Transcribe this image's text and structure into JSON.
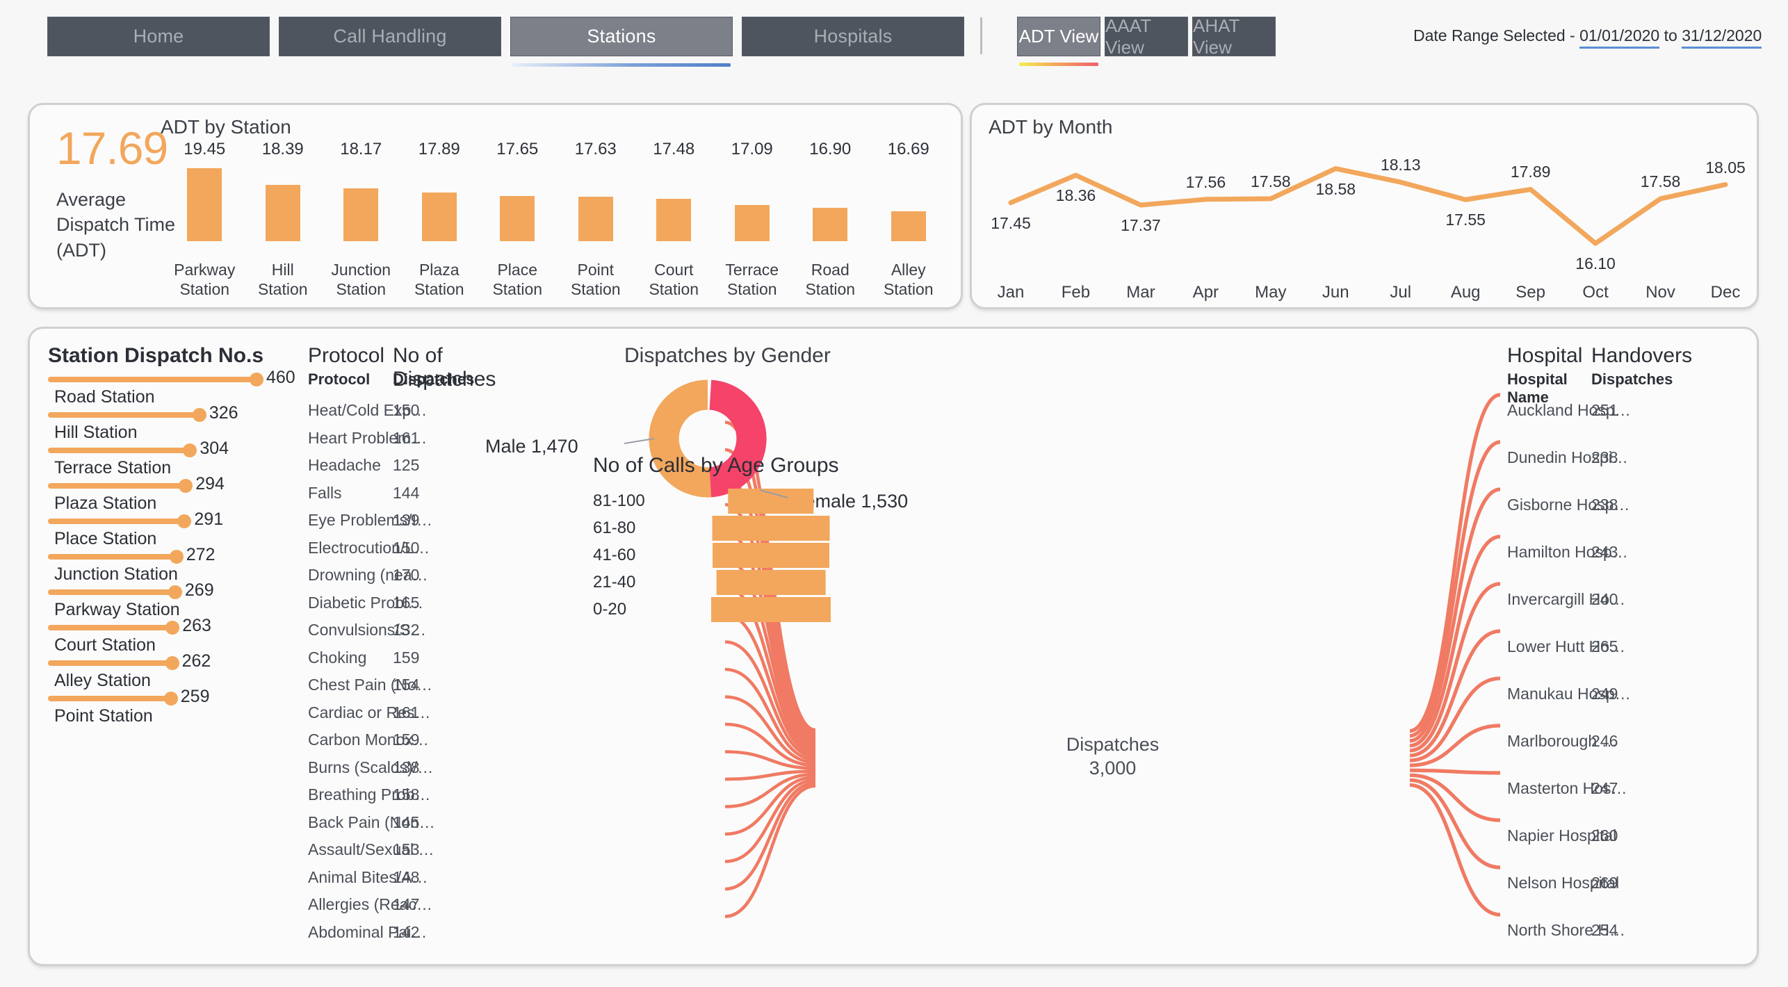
{
  "header": {
    "nav_tabs": [
      {
        "label": "Home",
        "active": false
      },
      {
        "label": "Call Handling",
        "active": false
      },
      {
        "label": "Stations",
        "active": true
      },
      {
        "label": "Hospitals",
        "active": false
      }
    ],
    "view_tabs": [
      {
        "label": "ADT View",
        "active": true
      },
      {
        "label": "AAAT View",
        "active": false
      },
      {
        "label": "AHAT View",
        "active": false
      }
    ],
    "date_range": {
      "prefix": "Date Range Selected - ",
      "from": "01/01/2020",
      "joiner": " to ",
      "to": "31/12/2020"
    }
  },
  "kpi": {
    "value": "17.69",
    "label": "Average Dispatch Time (ADT)"
  },
  "panels": {
    "adt_by_station_title": "ADT by Station",
    "adt_by_month_title": "ADT by Month",
    "station_dispatch_title": "Station Dispatch No.s",
    "gender_title": "Dispatches by Gender",
    "age_title": "No of Calls by Age Groups"
  },
  "protocol_table": {
    "header_big_left": "Protocol",
    "header_big_right": "No of Dispatches",
    "header_sm_left": "Protocol",
    "header_sm_right": "Dispatches"
  },
  "hospital_table": {
    "header_big_left": "Hospital",
    "header_big_right": "Handovers",
    "header_sm_left": "Hospital Name",
    "header_sm_right": "Dispatches"
  },
  "sankey": {
    "center_label": "Dispatches",
    "center_value": "3,000",
    "link_color": "#f07a63"
  },
  "colors": {
    "orange": "#f2a75c",
    "pink": "#f5436a",
    "salmon": "#f07a63",
    "tab_dark": "#4f555f",
    "tab_active": "#7c8089",
    "text_dark": "#2b2f36"
  },
  "chart_data": [
    {
      "type": "bar",
      "title": "ADT by Station",
      "xlabel": "",
      "ylabel": "",
      "categories": [
        "Parkway Station",
        "Hill Station",
        "Junction Station",
        "Plaza Station",
        "Place Station",
        "Point Station",
        "Court Station",
        "Terrace Station",
        "Road Station",
        "Alley Station"
      ],
      "values": [
        19.45,
        18.39,
        18.17,
        17.89,
        17.65,
        17.63,
        17.48,
        17.09,
        16.9,
        16.69
      ],
      "value_labels": [
        "19.45",
        "18.39",
        "18.17",
        "17.89",
        "17.65",
        "17.63",
        "17.48",
        "17.09",
        "16.90",
        "16.69"
      ],
      "ylim": [
        0,
        19.45
      ],
      "grid": false,
      "legend": "none"
    },
    {
      "type": "line",
      "title": "ADT by Month",
      "xlabel": "",
      "ylabel": "",
      "categories": [
        "Jan",
        "Feb",
        "Mar",
        "Apr",
        "May",
        "Jun",
        "Jul",
        "Aug",
        "Sep",
        "Oct",
        "Nov",
        "Dec"
      ],
      "values": [
        17.45,
        18.36,
        17.37,
        17.56,
        17.58,
        18.58,
        18.13,
        17.55,
        17.89,
        16.1,
        17.58,
        18.05
      ],
      "value_labels": [
        "17.45",
        "18.36",
        "17.37",
        "17.56",
        "17.58",
        "18.58",
        "18.13",
        "17.55",
        "17.89",
        "16.10",
        "17.58",
        "18.05"
      ],
      "label_positions": [
        "below",
        "below",
        "below",
        "above",
        "above",
        "below",
        "above",
        "below",
        "above",
        "below",
        "above",
        "above"
      ],
      "ylim": [
        16.1,
        18.58
      ],
      "grid": false,
      "legend": "none"
    },
    {
      "type": "bar",
      "title": "Station Dispatch No.s",
      "orientation": "horizontal-lollipop",
      "categories": [
        "Road Station",
        "Hill Station",
        "Terrace Station",
        "Plaza Station",
        "Place Station",
        "Junction Station",
        "Parkway Station",
        "Court Station",
        "Alley Station",
        "Point Station"
      ],
      "values": [
        460,
        326,
        304,
        294,
        291,
        272,
        269,
        263,
        262,
        259
      ],
      "value_labels": [
        "460",
        "326",
        "304",
        "294",
        "291",
        "272",
        "269",
        "263",
        "262",
        "259"
      ],
      "xlim": [
        0,
        460
      ],
      "grid": false,
      "legend": "none"
    },
    {
      "type": "table",
      "title": "No of Dispatches by Protocol",
      "columns": [
        "Protocol",
        "Dispatches"
      ],
      "rows": [
        [
          "Heat/Cold Exp…",
          "150"
        ],
        [
          "Heart Problem…",
          "161"
        ],
        [
          "Headache",
          "125"
        ],
        [
          "Falls",
          "144"
        ],
        [
          "Eye Problems/I…",
          "139"
        ],
        [
          "Electrocution/L…",
          "150"
        ],
        [
          "Drowning (nea…",
          "170"
        ],
        [
          "Diabetic Probl…",
          "165"
        ],
        [
          "Convulsions/S…",
          "132"
        ],
        [
          "Choking",
          "159"
        ],
        [
          "Chest Pain (No…",
          "154"
        ],
        [
          "Cardiac or Res…",
          "161"
        ],
        [
          "Carbon Monox…",
          "159"
        ],
        [
          "Burns (Scalds)/…",
          "138"
        ],
        [
          "Breathing Prob…",
          "158"
        ],
        [
          "Back Pain (Non…",
          "145"
        ],
        [
          "Assault/Sexual …",
          "153"
        ],
        [
          "Animal Bites/A…",
          "148"
        ],
        [
          "Allergies (Reac…",
          "147"
        ],
        [
          "Abdominal Pai…",
          "142"
        ]
      ]
    },
    {
      "type": "table",
      "title": "Handovers by Hospital",
      "columns": [
        "Hospital Name",
        "Dispatches"
      ],
      "rows": [
        [
          "Auckland Hosp…",
          "251"
        ],
        [
          "Dunedin Hospi…",
          "238"
        ],
        [
          "Gisborne Hosp…",
          "238"
        ],
        [
          "Hamilton Hosp…",
          "243"
        ],
        [
          "Invercargill Ho…",
          "240"
        ],
        [
          "Lower Hutt Ho…",
          "265"
        ],
        [
          "Manukau Hosp…",
          "249"
        ],
        [
          "Marlborough …",
          "246"
        ],
        [
          "Masterton Hos…",
          "247"
        ],
        [
          "Napier Hospital",
          "260"
        ],
        [
          "Nelson Hospital",
          "269"
        ],
        [
          "North Shore H…",
          "254"
        ]
      ]
    },
    {
      "type": "pie",
      "subtype": "donut",
      "title": "Dispatches by Gender",
      "labels": [
        "Male",
        "Female"
      ],
      "values": [
        1470,
        1530
      ],
      "value_labels": [
        "Male 1,470",
        "Female 1,530"
      ],
      "colors": [
        "#f5436a",
        "#f2a75c"
      ],
      "legend": "callout"
    },
    {
      "type": "bar",
      "subtype": "funnel-centered",
      "title": "No of Calls by Age Groups",
      "categories": [
        "81-100",
        "61-80",
        "41-60",
        "21-40",
        "0-20"
      ],
      "values": [
        122,
        167,
        166,
        155,
        170
      ],
      "grid": false,
      "legend": "none"
    }
  ]
}
